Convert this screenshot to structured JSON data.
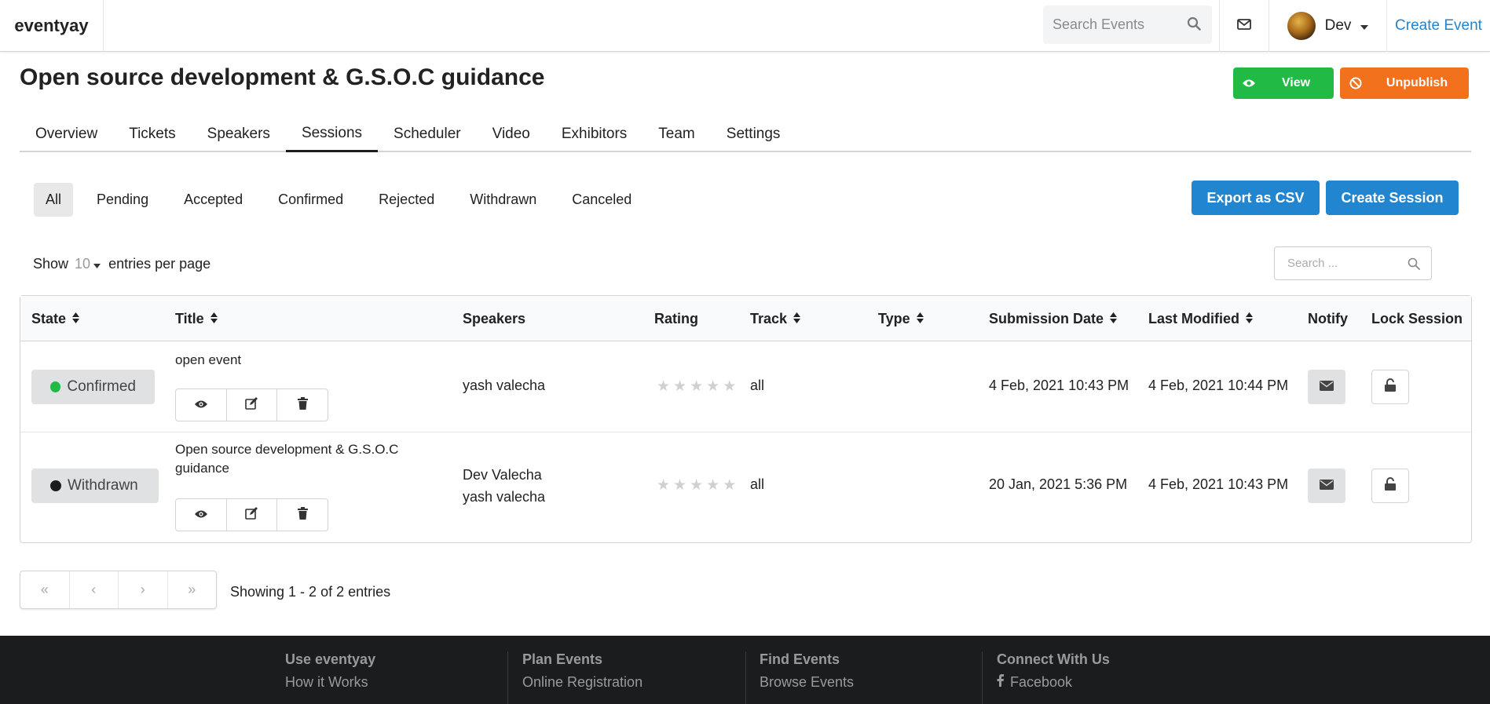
{
  "app": {
    "brand": "eventyay",
    "search_placeholder": "Search Events",
    "user_name": "Dev",
    "create_event": "Create Event"
  },
  "event": {
    "title": "Open source development & G.S.O.C guidance",
    "view_label": "View",
    "unpublish_label": "Unpublish"
  },
  "tabs": [
    "Overview",
    "Tickets",
    "Speakers",
    "Sessions",
    "Scheduler",
    "Video",
    "Exhibitors",
    "Team",
    "Settings"
  ],
  "active_tab": "Sessions",
  "filters": [
    "All",
    "Pending",
    "Accepted",
    "Confirmed",
    "Rejected",
    "Withdrawn",
    "Canceled"
  ],
  "active_filter": "All",
  "actions": {
    "export_csv": "Export as CSV",
    "create_session": "Create Session"
  },
  "entries": {
    "show": "Show",
    "count": "10",
    "per_page": "entries per page",
    "search_placeholder": "Search ..."
  },
  "table": {
    "headers": {
      "state": "State",
      "title": "Title",
      "speakers": "Speakers",
      "rating": "Rating",
      "track": "Track",
      "type": "Type",
      "submission_date": "Submission Date",
      "last_modified": "Last Modified",
      "notify": "Notify",
      "lock_session": "Lock Session"
    },
    "rows": [
      {
        "state": "Confirmed",
        "state_color": "#21ba45",
        "title": "open event",
        "speakers": [
          "yash valecha"
        ],
        "rating": 0,
        "track": "all",
        "type": "",
        "submission_date": "4 Feb, 2021 10:43 PM",
        "last_modified": "4 Feb, 2021 10:44 PM"
      },
      {
        "state": "Withdrawn",
        "state_color": "#1b1c1d",
        "title": "Open source development & G.S.O.C guidance",
        "speakers": [
          "Dev Valecha",
          "yash valecha"
        ],
        "rating": 0,
        "track": "all",
        "type": "",
        "submission_date": "20 Jan, 2021 5:36 PM",
        "last_modified": "4 Feb, 2021 10:43 PM"
      }
    ]
  },
  "pagination": {
    "first": "«",
    "prev": "‹",
    "next": "›",
    "last": "»",
    "showing": "Showing 1 - 2 of 2 entries"
  },
  "footer": {
    "columns": [
      {
        "heading": "Use eventyay",
        "link": "How it Works"
      },
      {
        "heading": "Plan Events",
        "link": "Online Registration"
      },
      {
        "heading": "Find Events",
        "link": "Browse Events"
      },
      {
        "heading": "Connect With Us",
        "link": "Facebook"
      }
    ]
  },
  "colors": {
    "accent": "#2185d0",
    "view_green": "#21ba45",
    "unpublish_orange": "#f2711c",
    "footer_bg": "#1b1c1d"
  }
}
